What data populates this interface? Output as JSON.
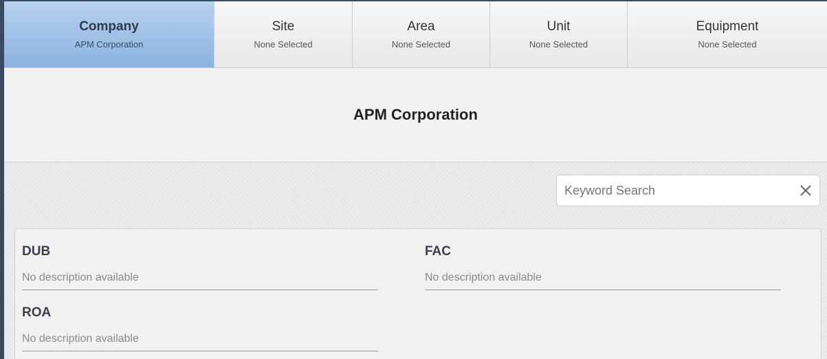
{
  "tabs": [
    {
      "title": "Company",
      "subtitle": "APM Corporation",
      "active": true
    },
    {
      "title": "Site",
      "subtitle": "None Selected",
      "active": false
    },
    {
      "title": "Area",
      "subtitle": "None Selected",
      "active": false
    },
    {
      "title": "Unit",
      "subtitle": "None Selected",
      "active": false
    },
    {
      "title": "Equipment",
      "subtitle": "None Selected",
      "active": false
    }
  ],
  "header": {
    "title": "APM Corporation"
  },
  "search": {
    "placeholder": "Keyword Search",
    "value": ""
  },
  "items": [
    {
      "code": "DUB",
      "description": "No description available"
    },
    {
      "code": "FAC",
      "description": "No description available"
    },
    {
      "code": "ROA",
      "description": "No description available"
    }
  ],
  "colors": {
    "active_tab": "#8ab3e0",
    "window_border": "#3a4a63"
  },
  "icons": {
    "clear": "close-icon"
  }
}
